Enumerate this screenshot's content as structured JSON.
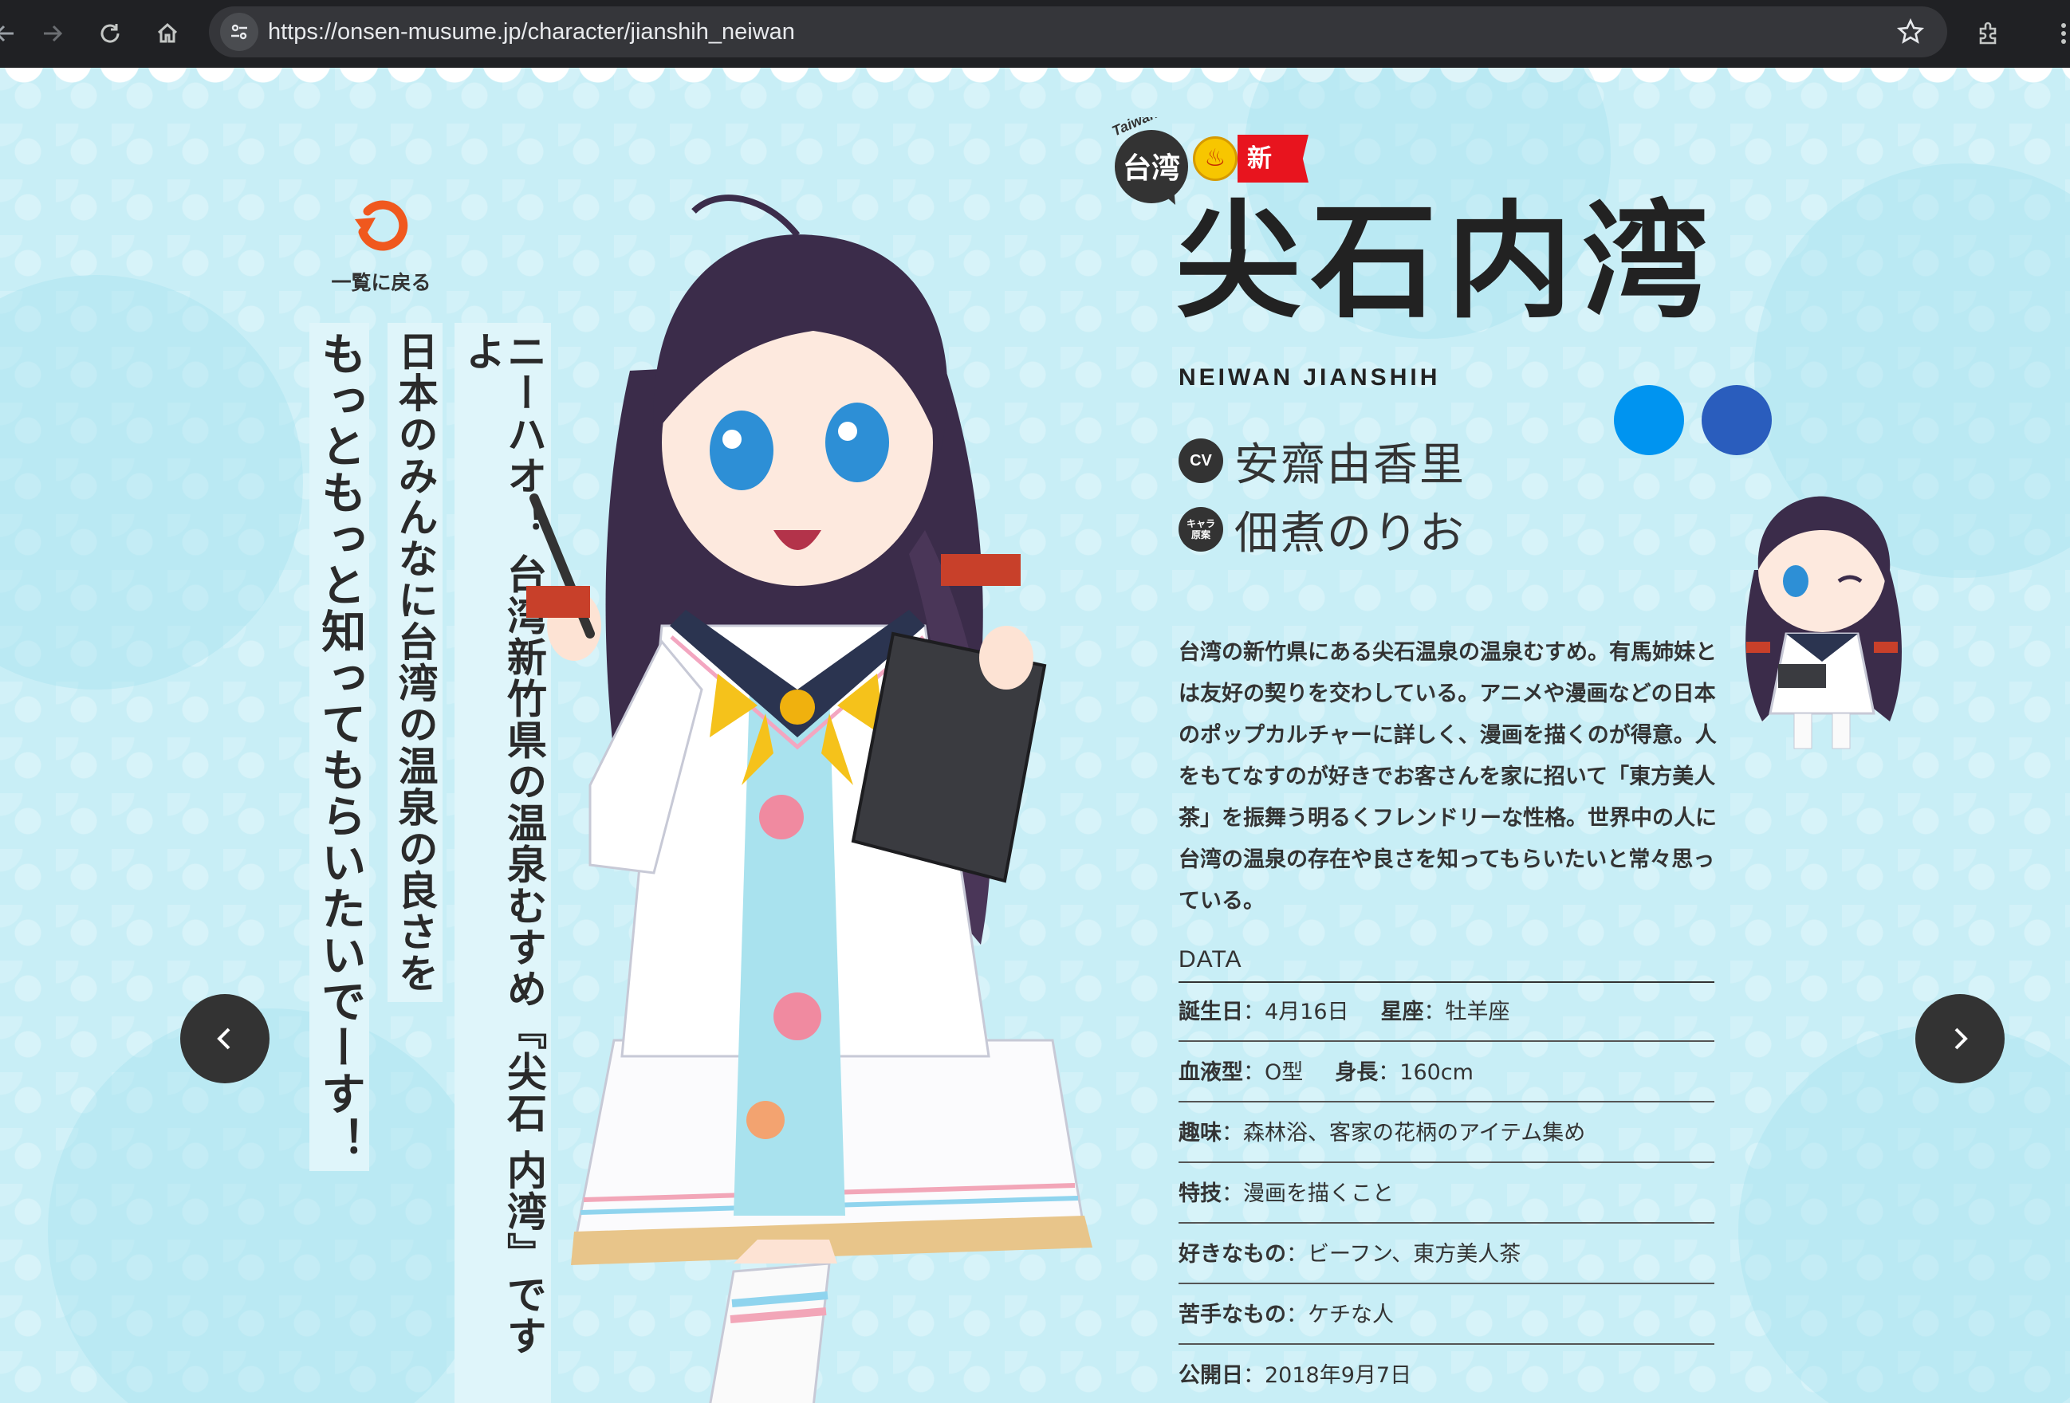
{
  "browser": {
    "url": "https://onsen-musume.jp/character/jianshih_neiwan"
  },
  "page": {
    "back_label": "一覧に戻る",
    "vertical_lines": [
      "ニーハオ！ 台湾新竹県の温泉むすめ『尖石 内湾』ですよ",
      "日本のみんなに台湾の温泉の良さを",
      "もっともっと知ってもらいたいでーす！"
    ],
    "region_badge": "台湾",
    "region_badge_en": "Taiwan",
    "ribbon": "新竹県温泉大使",
    "name_jp": "尖石内湾",
    "name_en": "NEIWAN JIANSHIH",
    "colors": [
      "#0094f0",
      "#2a5dbd"
    ],
    "cv_icon": "CV",
    "cv_name": "安齋由香里",
    "illust_icon": "キャラ原案",
    "illust_name": "佃煮のりお",
    "description": "台湾の新竹県にある尖石温泉の温泉むすめ。有馬姉妹とは友好の契りを交わしている。アニメや漫画などの日本のポップカルチャーに詳しく、漫画を描くのが得意。人をもてなすのが好きでお客さんを家に招いて「東方美人茶」を振舞う明るくフレンドリーな性格。世界中の人に台湾の温泉の存在や良さを知ってもらいたいと常々思っている。",
    "data_title": "DATA",
    "data": {
      "birthday_label": "誕生日",
      "birthday": "4月16日",
      "sign_label": "星座",
      "sign": "牡羊座",
      "blood_label": "血液型",
      "blood": "O型",
      "height_label": "身長",
      "height": "160cm",
      "hobby_label": "趣味",
      "hobby": "森林浴、客家の花柄のアイテム集め",
      "skill_label": "特技",
      "skill": "漫画を描くこと",
      "likes_label": "好きなもの",
      "likes": "ビーフン、東方美人茶",
      "dislikes_label": "苦手なもの",
      "dislikes": "ケチな人",
      "release_label": "公開日",
      "release": "2018年9月7日"
    }
  }
}
